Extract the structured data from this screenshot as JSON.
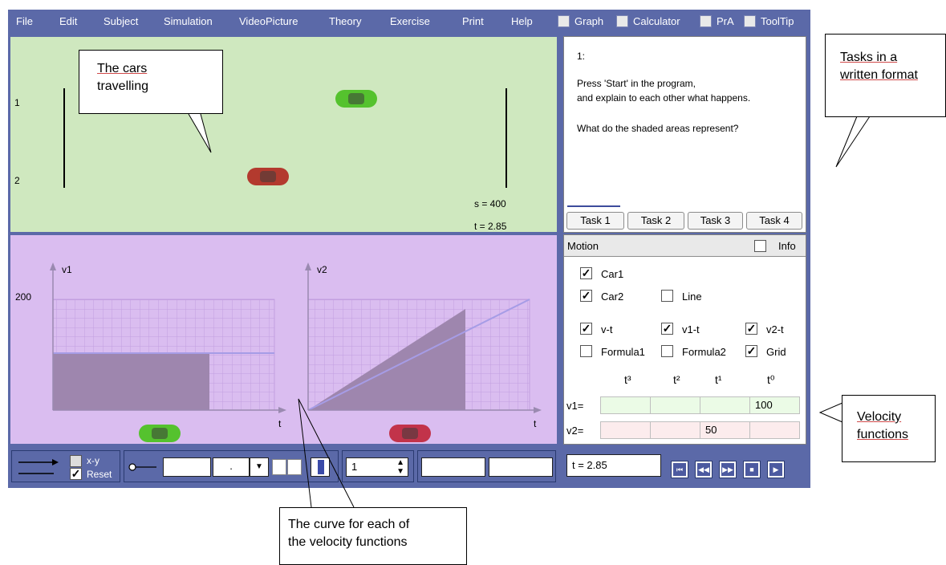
{
  "menu": {
    "items": [
      "File",
      "Edit",
      "Subject",
      "Simulation",
      "VideoPicture",
      "Theory",
      "Exercise",
      "Print",
      "Help"
    ],
    "toggles": [
      "Graph",
      "Calculator",
      "PrA",
      "ToolTip"
    ]
  },
  "animation": {
    "track_labels": [
      "1",
      "2"
    ],
    "s_readout": "s = 400",
    "t_readout": "t = 2.85",
    "car1_color": "#55c22e",
    "car2_color": "#b33a2e"
  },
  "graphs": {
    "left_title": "v1",
    "right_title": "v2",
    "y_tick": "200",
    "x_label": "t"
  },
  "tasks": {
    "number": "1:",
    "text_line1": "Press 'Start' in the program,",
    "text_line2": "and explain to each other what happens.",
    "question": "What do the shaded areas represent?",
    "buttons": [
      "Task 1",
      "Task 2",
      "Task 3",
      "Task 4"
    ]
  },
  "motion": {
    "title": "Motion",
    "info_label": "Info",
    "options": {
      "car1": "Car1",
      "car2": "Car2",
      "line": "Line",
      "vt": "v-t",
      "v1t": "v1-t",
      "v2t": "v2-t",
      "formula1": "Formula1",
      "formula2": "Formula2",
      "grid": "Grid"
    },
    "powers": [
      "t³",
      "t²",
      "t¹",
      "t⁰"
    ],
    "rows": [
      {
        "label": "v1=",
        "values": [
          "",
          "",
          "",
          "100"
        ]
      },
      {
        "label": "v2=",
        "values": [
          "",
          "",
          "50",
          ""
        ]
      }
    ]
  },
  "bottom": {
    "xy_label": "x-y",
    "reset_label": "Reset",
    "speed_value": "1",
    "dropdown_value": "."
  },
  "player": {
    "time": "t = 2.85"
  },
  "annotations": {
    "cars_line1": "The cars",
    "cars_line2": "travelling",
    "tasks_line1": "Tasks in a",
    "tasks_line2": "written format",
    "velocity_line1": "Velocity",
    "velocity_line2": "functions",
    "curve_line1": "The curve for each of",
    "curve_line2": "the velocity functions"
  },
  "chart_data": {
    "type": "area",
    "charts": [
      {
        "title": "v1",
        "function": "v1 = 100",
        "value": 100,
        "shaded_until_t": 2.85
      },
      {
        "title": "v2",
        "function": "v2 = 50t",
        "slope": 50,
        "shaded_until_t": 2.85
      }
    ],
    "y_tick_label": "200",
    "xlabel": "t",
    "grid": true
  }
}
